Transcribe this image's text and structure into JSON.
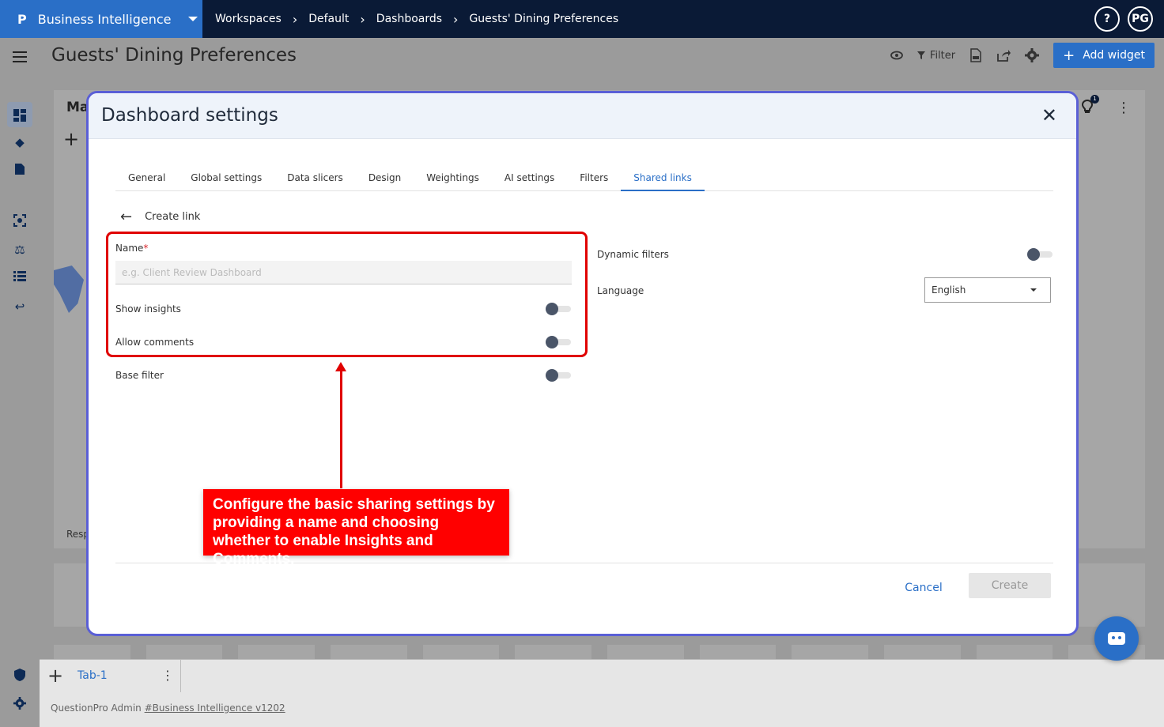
{
  "topbar": {
    "logo": "P",
    "product": "Business Intelligence",
    "breadcrumbs": [
      "Workspaces",
      "Default",
      "Dashboards",
      "Guests' Dining Preferences"
    ],
    "help_label": "?",
    "avatar_initials": "PG"
  },
  "header": {
    "page_title": "Guests' Dining Preferences",
    "filter_label": "Filter",
    "add_widget_label": "Add widget"
  },
  "widget": {
    "title_fragment": "Ma",
    "footer_fragment": "Resp",
    "badge_count": "1"
  },
  "tabbar": {
    "tab_label": "Tab-1"
  },
  "footer": {
    "prefix": "QuestionPro Admin",
    "link": "#Business Intelligence v1202"
  },
  "modal": {
    "title": "Dashboard settings",
    "tabs": [
      "General",
      "Global settings",
      "Data slicers",
      "Design",
      "Weightings",
      "AI settings",
      "Filters",
      "Shared links"
    ],
    "active_tab": "Shared links",
    "back_label": "Create link",
    "name_label": "Name",
    "name_required_mark": "*",
    "name_placeholder": "e.g. Client Review Dashboard",
    "name_value": "",
    "show_insights_label": "Show insights",
    "show_insights_on": false,
    "allow_comments_label": "Allow comments",
    "allow_comments_on": false,
    "base_filter_label": "Base filter",
    "base_filter_on": false,
    "dynamic_filters_label": "Dynamic filters",
    "dynamic_filters_on": false,
    "language_label": "Language",
    "language_value": "English",
    "cancel_label": "Cancel",
    "create_label": "Create"
  },
  "annotation": {
    "callout_text": "Configure the basic sharing settings by providing a name and choosing whether to enable Insights and Comments.",
    "color": "#ff0000"
  },
  "colors": {
    "brand": "#2a6fc7",
    "topbar": "#0a1a36",
    "modal_border": "#5a5fd6"
  }
}
